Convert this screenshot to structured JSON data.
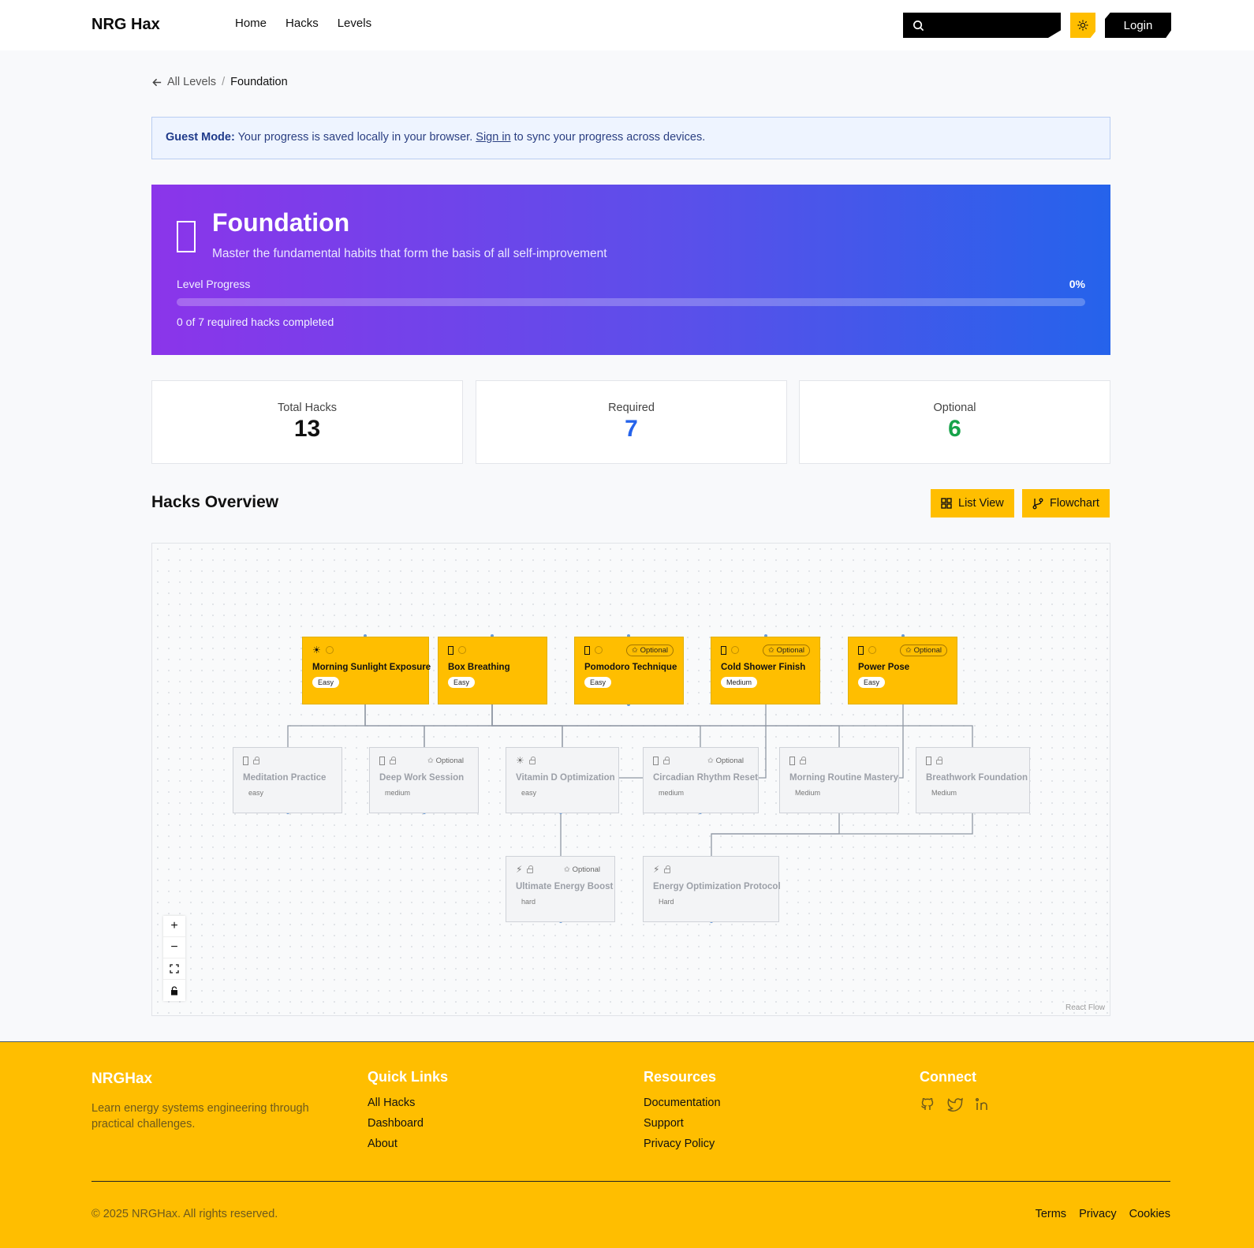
{
  "header": {
    "brand": "NRG Hax",
    "nav": [
      "Home",
      "Hacks",
      "Levels"
    ],
    "search_placeholder": "",
    "login_label": "Login"
  },
  "breadcrumb": {
    "back_label": "All Levels",
    "separator": "/",
    "current": "Foundation"
  },
  "guest_banner": {
    "strong": "Guest Mode:",
    "text_before": " Your progress is saved locally in your browser. ",
    "link": "Sign in",
    "text_after": " to sync your progress across devices."
  },
  "hero": {
    "title": "Foundation",
    "subtitle": "Master the fundamental habits that form the basis of all self-improvement",
    "progress_label": "Level Progress",
    "progress_percent_text": "0%",
    "progress_fraction": 0,
    "completed_text": "0 of 7 required hacks completed"
  },
  "stats": [
    {
      "label": "Total Hacks",
      "value": "13",
      "color": "#111111"
    },
    {
      "label": "Required",
      "value": "7",
      "color": "#2563eb"
    },
    {
      "label": "Optional",
      "value": "6",
      "color": "#16a34a"
    }
  ],
  "overview": {
    "title": "Hacks Overview",
    "list_view_label": "List View",
    "flowchart_label": "Flowchart",
    "attribution": "React Flow",
    "zoom_controls": [
      "+",
      "−",
      "fit-view",
      "lock"
    ]
  },
  "nodes": {
    "n1": {
      "icon": "sun-icon",
      "name": "Morning Sunlight Exposure",
      "difficulty": "Easy",
      "optional": "",
      "state": "available"
    },
    "n2": {
      "icon": "box-icon",
      "name": "Box Breathing",
      "difficulty": "Easy",
      "optional": "",
      "state": "available"
    },
    "n3": {
      "icon": "box-icon",
      "name": "Pomodoro Technique",
      "difficulty": "Easy",
      "optional": "Optional",
      "state": "available"
    },
    "n4": {
      "icon": "box-icon",
      "name": "Cold Shower Finish",
      "difficulty": "Medium",
      "optional": "Optional",
      "state": "available"
    },
    "n5": {
      "icon": "box-icon",
      "name": "Power Pose",
      "difficulty": "Easy",
      "optional": "Optional",
      "state": "available"
    },
    "n6": {
      "icon": "box-icon",
      "name": "Meditation Practice",
      "difficulty": "easy",
      "optional": "",
      "state": "locked"
    },
    "n7": {
      "icon": "box-icon",
      "name": "Deep Work Session",
      "difficulty": "medium",
      "optional": "Optional",
      "state": "locked"
    },
    "n8": {
      "icon": "sun-icon",
      "name": "Vitamin D Optimization",
      "difficulty": "easy",
      "optional": "",
      "state": "locked"
    },
    "n9": {
      "icon": "box-icon",
      "name": "Circadian Rhythm Reset",
      "difficulty": "medium",
      "optional": "Optional",
      "state": "locked"
    },
    "n10": {
      "icon": "box-icon",
      "name": "Morning Routine Mastery",
      "difficulty": "Medium",
      "optional": "",
      "state": "locked"
    },
    "n11": {
      "icon": "box-icon",
      "name": "Breathwork Foundation",
      "difficulty": "Medium",
      "optional": "",
      "state": "locked"
    },
    "n12": {
      "icon": "bolt-icon",
      "name": "Ultimate Energy Boost",
      "difficulty": "hard",
      "optional": "Optional",
      "state": "locked"
    },
    "n13": {
      "icon": "bolt-icon",
      "name": "Energy Optimization Protocol",
      "difficulty": "Hard",
      "optional": "",
      "state": "locked"
    }
  },
  "footer": {
    "brand": "NRGHax",
    "description": "Learn energy systems engineering through practical challenges.",
    "quick_links_title": "Quick Links",
    "quick_links": [
      "All Hacks",
      "Dashboard",
      "About"
    ],
    "resources_title": "Resources",
    "resources": [
      "Documentation",
      "Support",
      "Privacy Policy"
    ],
    "connect_title": "Connect",
    "social_icons": [
      "github-icon",
      "twitter-icon",
      "linkedin-icon"
    ],
    "copyright": "© 2025 NRGHax. All rights reserved.",
    "legal": [
      "Terms",
      "Privacy",
      "Cookies"
    ]
  },
  "colors": {
    "accent": "#ffbe00",
    "hero_start": "#8b35ea",
    "hero_end": "#2563eb",
    "required": "#2563eb",
    "optional": "#16a34a"
  }
}
